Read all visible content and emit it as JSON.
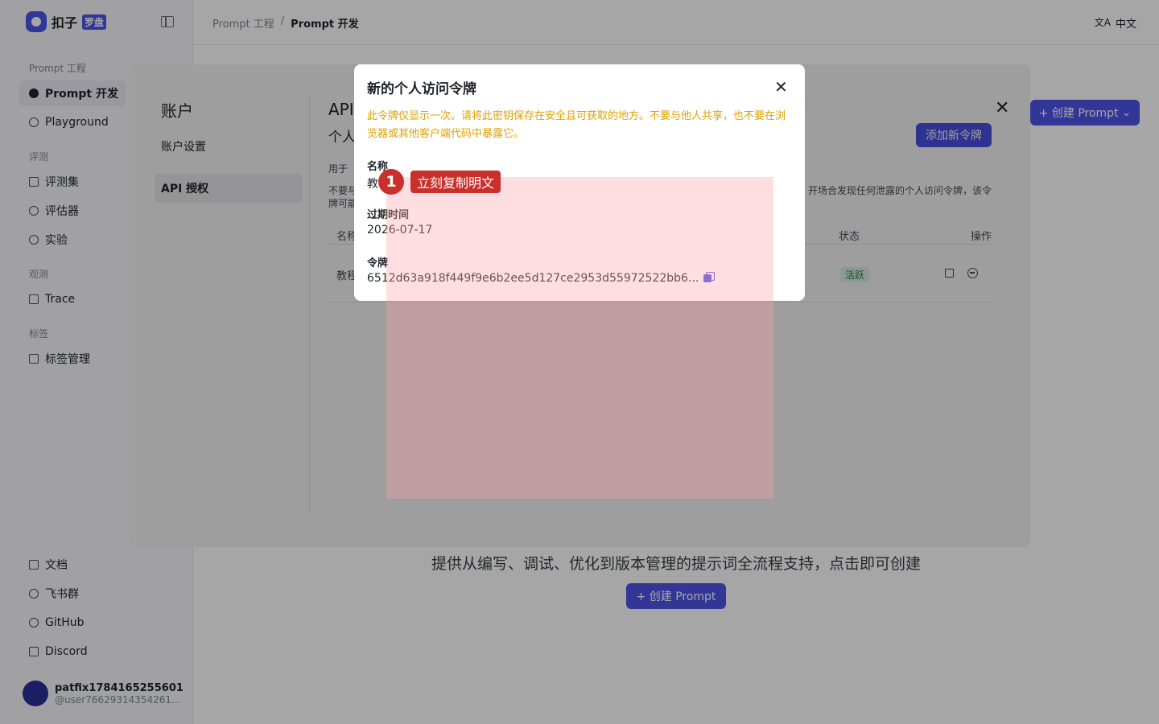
{
  "app": {
    "logo_text": "扣子",
    "logo_badge": "罗盘"
  },
  "sidebar": {
    "sections": [
      {
        "title": "Prompt 工程",
        "items": [
          {
            "label": "Prompt 开发",
            "icon": "prompt-icon",
            "active": true
          },
          {
            "label": "Playground",
            "icon": "play-icon",
            "active": false
          }
        ]
      },
      {
        "title": "评测",
        "items": [
          {
            "label": "评测集",
            "icon": "dataset-icon"
          },
          {
            "label": "评估器",
            "icon": "evaluator-icon"
          },
          {
            "label": "实验",
            "icon": "experiment-icon"
          }
        ]
      },
      {
        "title": "观测",
        "items": [
          {
            "label": "Trace",
            "icon": "trace-icon"
          }
        ]
      },
      {
        "title": "标签",
        "items": [
          {
            "label": "标签管理",
            "icon": "tag-icon"
          }
        ]
      }
    ],
    "footer": [
      {
        "label": "文档",
        "icon": "doc-icon"
      },
      {
        "label": "飞书群",
        "icon": "feishu-icon"
      },
      {
        "label": "GitHub",
        "icon": "github-icon"
      },
      {
        "label": "Discord",
        "icon": "discord-icon"
      }
    ],
    "user": {
      "name": "patfix1784165255601",
      "handle": "@user76629314354261..."
    }
  },
  "topbar": {
    "breadcrumb": [
      "Prompt 工程",
      "/",
      "Prompt 开发"
    ],
    "language": "中文"
  },
  "main": {
    "create_button": "+ 创建 Prompt",
    "empty_description": "提供从编写、调试、优化到版本管理的提示词全流程支持，点击即可创建",
    "create_center_button": "+ 创建 Prompt"
  },
  "account_modal": {
    "title": "账户",
    "nav": [
      {
        "label": "账户设置",
        "active": false
      },
      {
        "label": "API 授权",
        "active": true
      }
    ],
    "api_heading": "API",
    "api_subheading": "个人",
    "add_token_button": "添加新令牌",
    "desc1": "用于",
    "desc2_left": "不要与",
    "desc2_right": "开场合发现任何泄露的个人访问令牌，该令",
    "desc3": "牌可能",
    "table": {
      "headers": {
        "name": "名称",
        "status": "状态",
        "action": "操作"
      },
      "rows": [
        {
          "name": "教程",
          "status": "活跃"
        }
      ]
    }
  },
  "token_modal": {
    "title": "新的个人访问令牌",
    "warning": "此令牌仅显示一次。请将此密钥保存在安全且可获取的地方。不要与他人共享，也不要在浏览器或其他客户端代码中暴露它。",
    "name_label": "名称",
    "name_value": "教",
    "expiry_label": "过期时间",
    "expiry_value": "2026-07-17",
    "token_label": "令牌",
    "token_value": "6512d63a918f449f9e6b2ee5d127ce2953d55972522bb6..."
  },
  "annotation": {
    "number": "1",
    "label": "立刻复制明文"
  },
  "colors": {
    "accent": "#4d53e8",
    "warning": "#e0a100",
    "annotation": "#c9302c",
    "status_active_bg": "#e3f7ea",
    "status_active_text": "#1b8a4c"
  }
}
